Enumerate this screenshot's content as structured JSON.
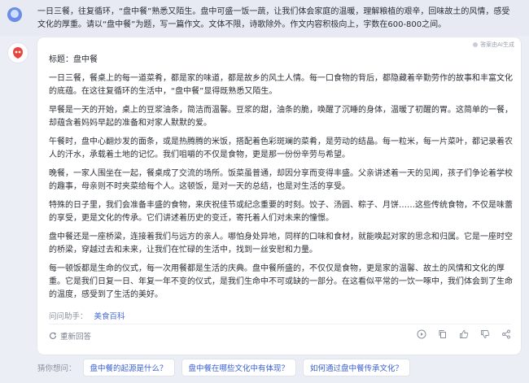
{
  "user": {
    "prompt": "一日三餐，往复循环，“盘中餐”熟悉又陌生。盘中可盛一饭一蔬，让我们体会家庭的温暖，理解粮植的艰辛，回味故土的风情，感受文化的厚重。请以“盘中餐”为题，写一篇作文。文体不限，诗歌除外。作文内容积极向上，字数在600-800之间。"
  },
  "answer": {
    "badge": "答案由AI生成",
    "title": "标题：盘中餐",
    "paragraphs": [
      "一日三餐，餐桌上的每一道菜肴，都是家的味道，都是故乡的风土人情。每一口食物的背后，都隐藏着辛勤劳作的故事和丰富文化的底蕴。在这往复循环的生活中，“盘中餐”显得既熟悉又陌生。",
      "早餐是一天的开始，桌上的豆浆油条，简洁而温馨。豆浆的甜，油条的脆，唤醒了沉睡的身体，温暖了初醒的胃。这简单的一餐，却蕴含着妈妈早起的准备和对家人默默的爱。",
      "午餐时，盘中心翻炒发的面条，或是热腾腾的米饭，搭配着色彩斑斓的菜肴，是劳动的结晶。每一粒米，每一片菜叶，都记录着农人的汗水，承载着土地的记忆。我们咀嚼的不仅是食物，更是那一份份辛劳与希望。",
      "晚餐，一家人围坐在一起，餐桌成了交流的场所。饭菜虽普通，却因分享而变得丰盛。父亲讲述着一天的见闻，孩子们争论着学校的趣事，母亲则不时夹菜给每个人。这顿饭，是对一天的总结，也是对生活的享受。",
      "特殊的日子里，我们会准备丰盛的食物，来庆祝佳节或纪念重要的时刻。饺子、汤圆、粽子、月饼……这些传统食物，不仅是味蕾的享受，更是文化的传承。它们讲述着历史的变迁，寄托着人们对未来的憧憬。",
      "盘中餐还是一座桥梁，连接着我们与远方的亲人。哪怕身处异地，同样的口味和食材，就能唤起对家的思念和归属。它是一座时空的桥梁，穿越过去和未来，让我们在忙碌的生活中，找到一丝安慰和力量。",
      "每一顿饭都是生命的仪式，每一次用餐都是生活的庆典。盘中餐所盛的，不仅仅是食物，更是家的温馨、故土的风情和文化的厚重。它是我们日复一日、年复一年不变的仪式，是我们生命中不可或缺的一部分。在这看似平常的一饮一啄中，我们体会到了生命的温度，感受到了生活的美好。"
    ],
    "source_label": "问问助手：",
    "source_tag": "美食百科",
    "regenerate_label": "重新回答"
  },
  "suggestions": {
    "label": "猜你想问：",
    "items": [
      "盘中餐的起源是什么？",
      "盘中餐在哪些文化中有体现？",
      "如何通过盘中餐传承文化？"
    ]
  },
  "colors": {
    "accent": "#3a5fd0",
    "background": "#eceef5"
  }
}
